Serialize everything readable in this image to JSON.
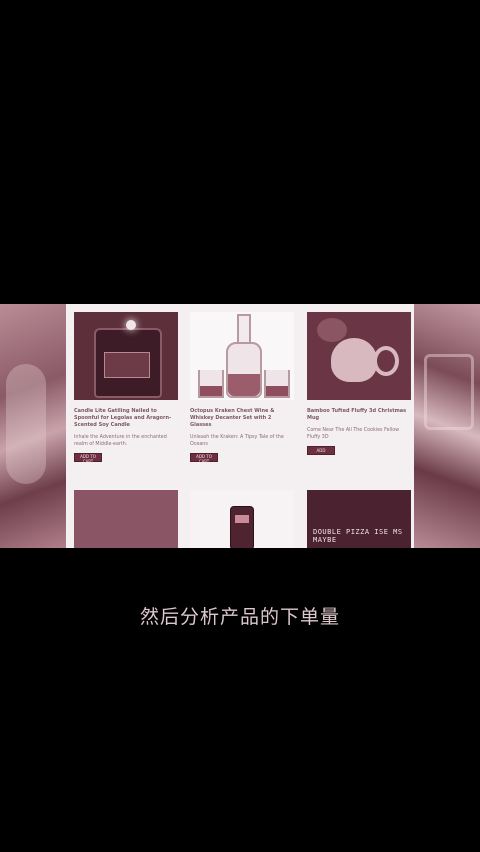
{
  "products": [
    {
      "title": "Candle Lite Gatiling Nailed to Spoonful for Legolas and Aragorn-Scented Soy Candle",
      "description": "Inhale the Adventure in the enchanted realm of Middle-earth.",
      "button_label": "ADD TO CART"
    },
    {
      "title": "Octopus Kraken Chest Wine & Whiskey Decanter Set with 2 Glasses",
      "description": "Unleash the Kraken: A Tipsy Tale of the Oceans",
      "button_label": "ADD TO CART"
    },
    {
      "title": "Bamboo Tufted Fluffy 3d Christmas Mug",
      "description": "Come Near The All The Cookies Fellow Fluffy 3D",
      "button_label": "ADD"
    }
  ],
  "row2_sign_text": "DOUBLE PIZZA ISE MS MAYBE",
  "subtitle": "然后分析产品的下单量"
}
